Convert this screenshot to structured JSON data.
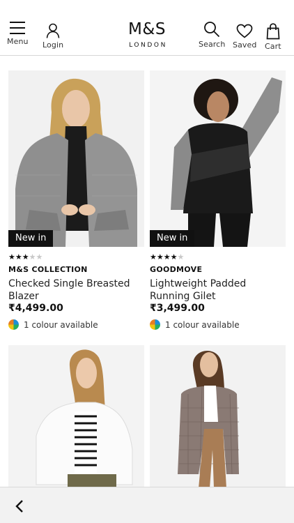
{
  "header": {
    "menu_label": "Menu",
    "login_label": "Login",
    "logo_main": "M&S",
    "logo_sub": "LONDON",
    "search_label": "Search",
    "saved_label": "Saved",
    "cart_label": "Cart"
  },
  "products": [
    {
      "badge": "New in",
      "rating": 2.5,
      "brand": "M&S COLLECTION",
      "title": "Checked Single Breasted Blazer",
      "price": "₹4,499.00",
      "colours": "1 colour available"
    },
    {
      "badge": "New in",
      "rating": 4.5,
      "brand": "GOODMOVE",
      "title": "Lightweight Padded Running Gilet",
      "price": "₹3,499.00",
      "colours": "1 colour available"
    },
    {
      "image": "woman in white denim jacket and striped top"
    },
    {
      "image": "woman in checked trench coat and brown trousers"
    }
  ],
  "icons": {
    "menu": "menu-icon",
    "login": "user-icon",
    "search": "search-icon",
    "saved": "heart-icon",
    "cart": "bag-icon",
    "back": "chevron-left-icon"
  }
}
